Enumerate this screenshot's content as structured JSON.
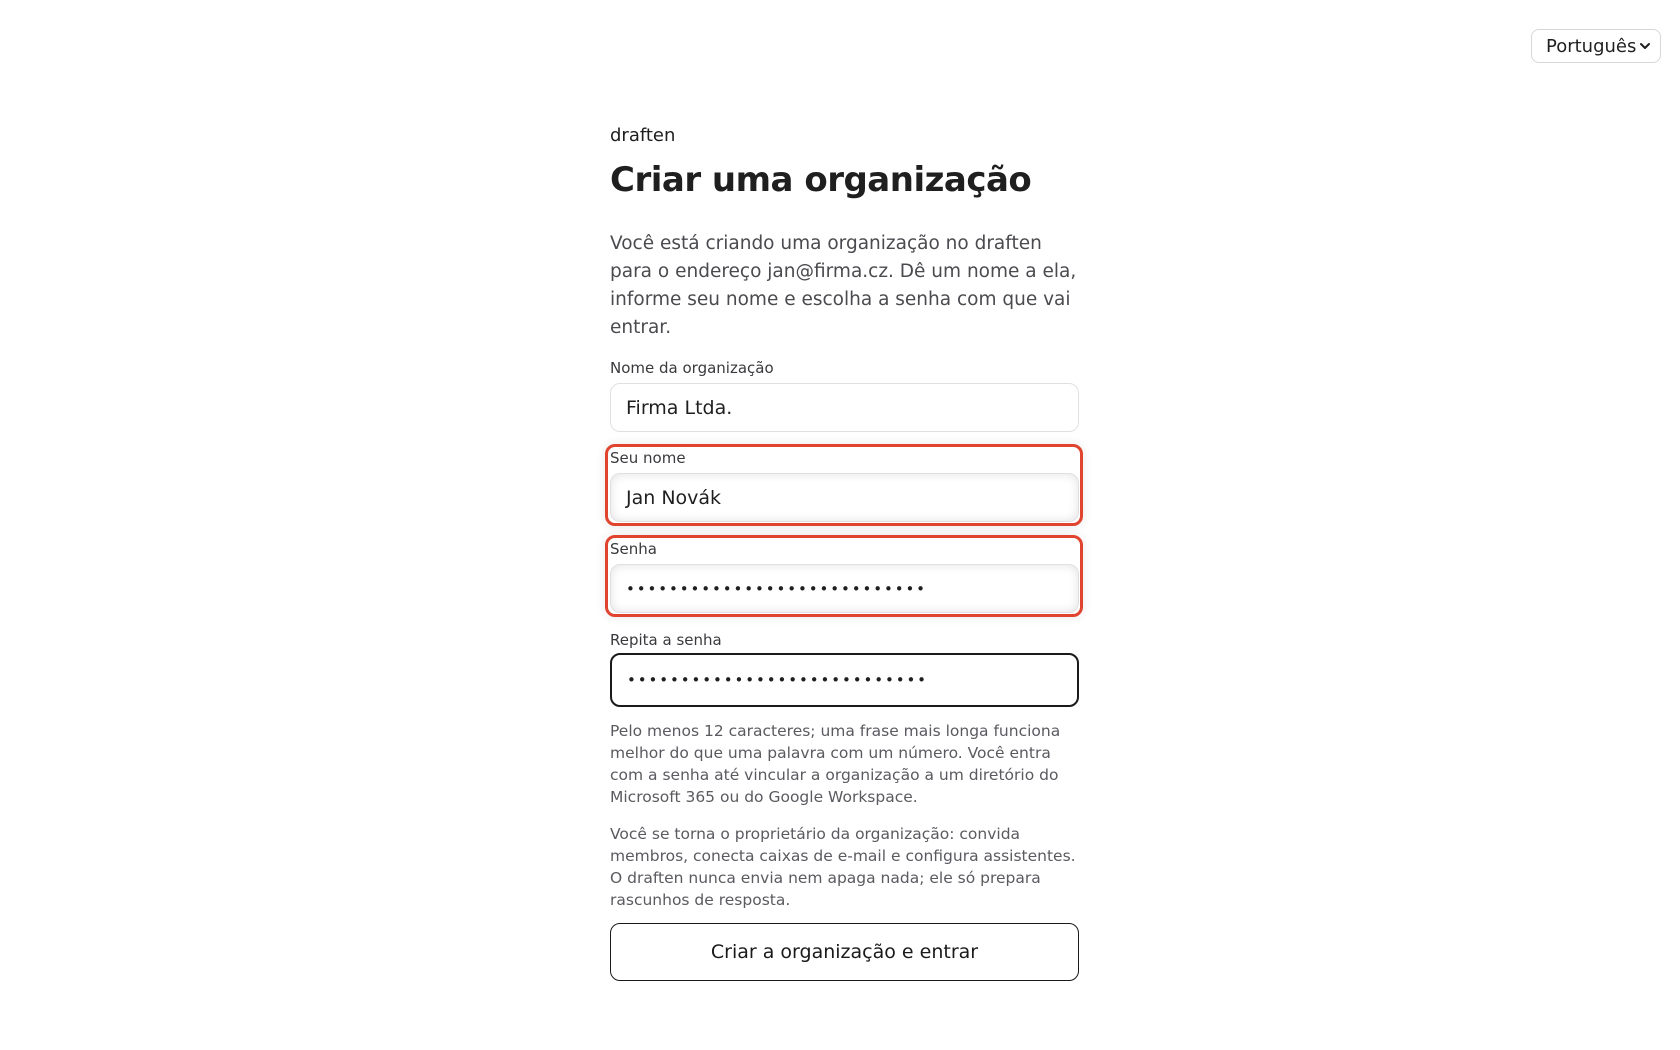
{
  "language_select": {
    "value": "Português"
  },
  "brand": "draften",
  "title": "Criar uma organização",
  "intro": "Você está criando uma organização no draften para o endereço jan@firma.cz. Dê um nome a ela, informe seu nome e escolha a senha com que vai entrar.",
  "fields": {
    "org_name": {
      "label": "Nome da organização",
      "value": "Firma Ltda."
    },
    "your_name": {
      "label": "Seu nome",
      "value": "Jan Novák"
    },
    "password": {
      "label": "Senha",
      "value": "••••••••••••••••••••••••••••"
    },
    "password_repeat": {
      "label": "Repita a senha",
      "value": "••••••••••••••••••••••••••••"
    }
  },
  "password_help": "Pelo menos 12 caracteres; uma frase mais longa funciona melhor do que uma palavra com um número. Você entra com a senha até vincular a organização a um diretório do Microsoft 365 ou do Google Workspace.",
  "owner_note": "Você se torna o proprietário da organização: convida membros, conecta caixas de e-mail e configura assistentes. O draften nunca envia nem apaga nada; ele só prepara rascunhos de resposta.",
  "submit_label": "Criar a organização e entrar",
  "colors": {
    "highlight": "#e0442f",
    "text": "#1d1d1f",
    "muted": "#5a5a60"
  }
}
